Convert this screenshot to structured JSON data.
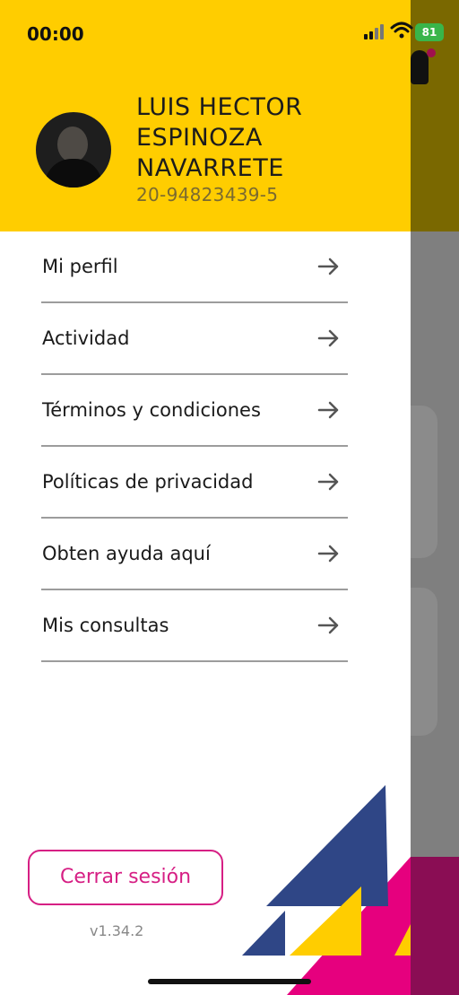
{
  "status_bar": {
    "time": "00:00",
    "battery": "81"
  },
  "profile": {
    "name_lines": [
      "LUIS HECTOR",
      "ESPINOZA",
      "NAVARRETE"
    ],
    "id": "20-94823439-5"
  },
  "menu": {
    "items": [
      {
        "label": "Mi perfil"
      },
      {
        "label": "Actividad"
      },
      {
        "label": "Términos y condiciones"
      },
      {
        "label": "Políticas de privacidad"
      },
      {
        "label": "Obten ayuda aquí"
      },
      {
        "label": "Mis consultas"
      }
    ]
  },
  "logout_label": "Cerrar sesión",
  "version": "v1.34.2",
  "colors": {
    "header": "#ffcd00",
    "accent": "#d61f84",
    "navy": "#2f4686",
    "yellow": "#ffcd00",
    "magenta": "#e6007e"
  },
  "icons": {
    "arrow": "arrow-right-icon",
    "signal": "signal-icon",
    "wifi": "wifi-icon",
    "battery": "battery-icon"
  }
}
